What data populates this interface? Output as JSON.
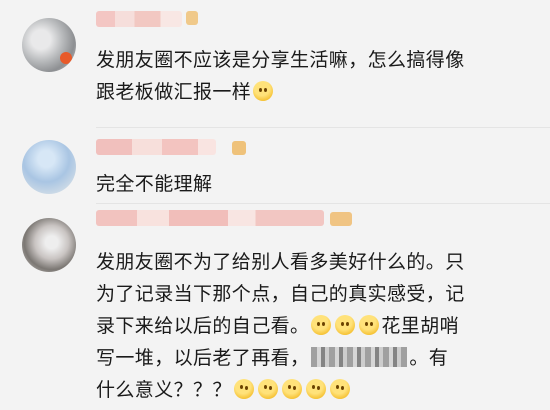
{
  "comments": [
    {
      "lines": [
        "发朋友圈不应该是分享生活嘛，怎么搞得像",
        "跟老板做汇报一样"
      ],
      "trailing_emoji": "laughing-tears-emoji"
    },
    {
      "lines": [
        "完全不能理解"
      ]
    },
    {
      "line1": "发朋友圈不为了给别人看多美好什么的。只",
      "line2": "为了记录当下那个点，自己的真实感受，记",
      "line3_before": "录下来给以后的自己看。",
      "line3_after": "花里胡哨",
      "line4_before": "写一堆，以后老了再看，",
      "line4_after": "。有",
      "line5": "什么意义？？？"
    }
  ]
}
